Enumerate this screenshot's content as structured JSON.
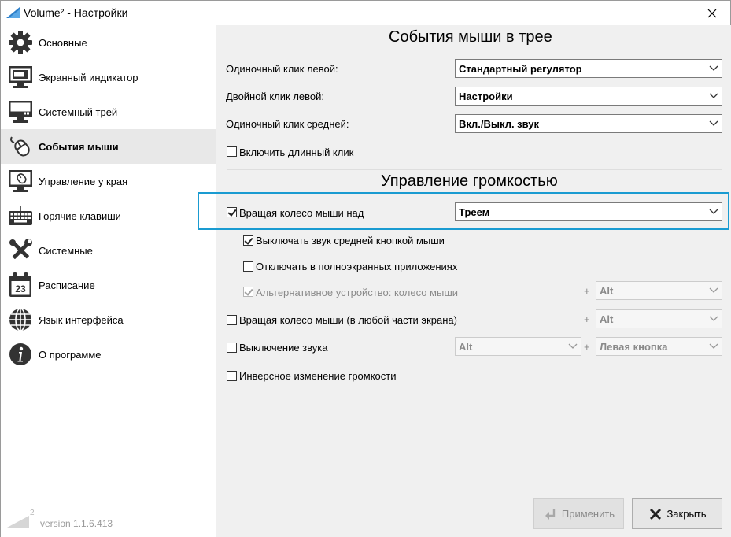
{
  "window": {
    "title": "Volume² - Настройки"
  },
  "sidebar": {
    "items": [
      {
        "label": "Основные",
        "icon": "gear-icon"
      },
      {
        "label": "Экранный индикатор",
        "icon": "monitor-icon"
      },
      {
        "label": "Системный трей",
        "icon": "tray-icon"
      },
      {
        "label": "События мыши",
        "icon": "mouse-icon",
        "active": true
      },
      {
        "label": "Управление у края",
        "icon": "screen-edge-mouse-icon"
      },
      {
        "label": "Горячие клавиши",
        "icon": "keyboard-icon"
      },
      {
        "label": "Системные",
        "icon": "tools-icon"
      },
      {
        "label": "Расписание",
        "icon": "calendar-icon"
      },
      {
        "label": "Язык интерфейса",
        "icon": "globe-icon"
      },
      {
        "label": "О программе",
        "icon": "info-icon"
      }
    ],
    "calendar_day": "23",
    "version": "version 1.1.6.413",
    "version_logo_sup": "2"
  },
  "tray_events": {
    "title": "События мыши в трее",
    "rows": [
      {
        "label": "Одиночный клик левой:",
        "value": "Стандартный регулятор"
      },
      {
        "label": "Двойной клик левой:",
        "value": "Настройки"
      },
      {
        "label": "Одиночный клик средней:",
        "value": "Вкл./Выкл. звук"
      }
    ],
    "long_click": {
      "label": "Включить длинный клик",
      "checked": false
    }
  },
  "volume_control": {
    "title": "Управление громкостью",
    "wheel_over": {
      "label": "Вращая колесо мыши над",
      "checked": true,
      "value": "Треем"
    },
    "mute_middle": {
      "label": "Выключать звук средней кнопкой мыши",
      "checked": true
    },
    "disable_fullscreen": {
      "label": "Отключать в полноэкранных приложениях",
      "checked": false
    },
    "alt_device": {
      "label": "Альтернативное устройство: колесо мыши",
      "checked": true,
      "disabled": true,
      "mod": "Alt"
    },
    "wheel_anywhere": {
      "label": "Вращая колесо мыши (в любой части экрана)",
      "checked": false,
      "mod": "Alt"
    },
    "mute": {
      "label": "Выключение звука",
      "checked": false,
      "mod1": "Alt",
      "mod2": "Левая кнопка"
    },
    "inverse": {
      "label": "Инверсное изменение громкости",
      "checked": false
    },
    "plus": "+"
  },
  "buttons": {
    "apply": "Применить",
    "close": "Закрыть"
  },
  "colors": {
    "highlight": "#1a9bd1",
    "panel_bg": "#f0f0f0",
    "active_nav_bg": "#e8e8e8"
  }
}
